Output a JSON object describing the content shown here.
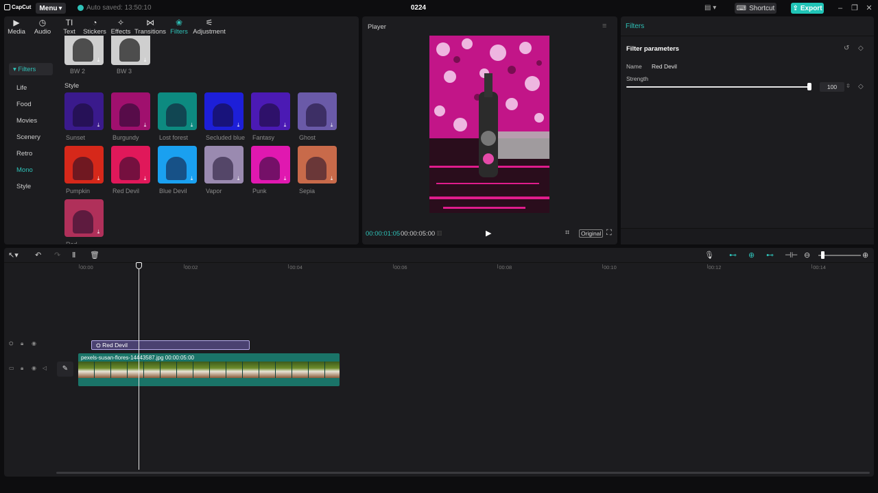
{
  "titlebar": {
    "logo": "CapCut",
    "menu_label": "Menu",
    "autosave": "Auto saved: 13:50:10",
    "project_title": "0224",
    "shortcut_label": "Shortcut",
    "export_label": "Export"
  },
  "tabs": [
    {
      "label": "Media",
      "icon": "media-icon"
    },
    {
      "label": "Audio",
      "icon": "audio-icon"
    },
    {
      "label": "Text",
      "icon": "text-icon"
    },
    {
      "label": "Stickers",
      "icon": "stickers-icon"
    },
    {
      "label": "Effects",
      "icon": "effects-icon"
    },
    {
      "label": "Transitions",
      "icon": "transitions-icon"
    },
    {
      "label": "Filters",
      "icon": "filters-icon"
    },
    {
      "label": "Adjustment",
      "icon": "adjustment-icon"
    }
  ],
  "active_tab": "Filters",
  "sidebar": {
    "header": "Filters",
    "items": [
      "Life",
      "Food",
      "Movies",
      "Scenery",
      "Retro",
      "Mono",
      "Style"
    ],
    "active": "Mono"
  },
  "filters": {
    "top_row": [
      {
        "name": "BW 2"
      },
      {
        "name": "BW 3"
      }
    ],
    "section": "Style",
    "style_row1": [
      {
        "name": "Sunset",
        "color": "#3a1a8c"
      },
      {
        "name": "Burgundy",
        "color": "#a0106e"
      },
      {
        "name": "Lost forest",
        "color": "#0d8a80"
      },
      {
        "name": "Secluded blue",
        "color": "#1d1fd8"
      },
      {
        "name": "Fantasy",
        "color": "#4b1ab4"
      },
      {
        "name": "Ghost",
        "color": "#6a5aa8"
      }
    ],
    "style_row2": [
      {
        "name": "Pumpkin",
        "color": "#d6281a"
      },
      {
        "name": "Red Devil",
        "color": "#e0185a"
      },
      {
        "name": "Blue Devil",
        "color": "#1aa0f0"
      },
      {
        "name": "Vapor",
        "color": "#9a8ab0"
      },
      {
        "name": "Punk",
        "color": "#e018b0"
      },
      {
        "name": "Sepia",
        "color": "#c86a4a"
      }
    ],
    "style_row3": [
      {
        "name": "Red",
        "color": "#b0305a"
      }
    ]
  },
  "player": {
    "title": "Player",
    "timecode_current": "00:00:01:05",
    "timecode_total": "00:00:05:00",
    "original_label": "Original"
  },
  "right_panel": {
    "title": "Filters",
    "params_title": "Filter parameters",
    "name_label": "Name",
    "name_value": "Red Devil",
    "strength_label": "Strength",
    "strength_value": "100",
    "strength_fraction": 1.0
  },
  "timeline": {
    "ruler": [
      "00:00",
      "00:02",
      "00:04",
      "00:06",
      "00:08",
      "00:10",
      "00:12",
      "00:14"
    ],
    "filter_clip_label": "Red Devil",
    "video_clip_label": "pexels-susan-flores-14443587.jpg  00:00:05:00"
  },
  "colors": {
    "accent": "#2fc2b8",
    "filter_clip": "#4a4170",
    "video_clip": "#1a7468"
  }
}
